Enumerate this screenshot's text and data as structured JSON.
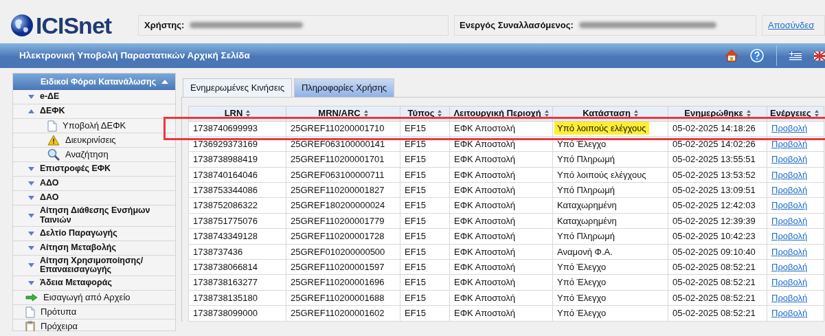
{
  "header": {
    "logo": "ICISnet",
    "user_label": "Χρήστης:",
    "trader_label": "Ενεργός Συναλλασόμενος:",
    "logout": "Αποσύνδεσ"
  },
  "title_bar": {
    "title": "Ηλεκτρονική Υποβολή Παραστατικών Αρχική Σελίδα"
  },
  "sidebar": {
    "title": "Ειδικοί Φόροι Κατανάλωσης",
    "expanded": true,
    "items": [
      {
        "kind": "group",
        "label": "e-ΔΕ",
        "expanded": false
      },
      {
        "kind": "group",
        "label": "ΔΕΦΚ",
        "expanded": true,
        "children": [
          {
            "kind": "document",
            "label": "Υποβολή ΔΕΦΚ"
          },
          {
            "kind": "warning",
            "label": "Διευκρινίσεις"
          },
          {
            "kind": "search",
            "label": "Αναζήτηση"
          }
        ]
      },
      {
        "kind": "group",
        "label": "Επιστροφές ΕΦΚ",
        "expanded": false
      },
      {
        "kind": "group",
        "label": "ΑΔΟ",
        "expanded": false
      },
      {
        "kind": "group",
        "label": "ΔΑΟ",
        "expanded": false
      },
      {
        "kind": "group",
        "label": "Αίτηση Διάθεσης Ενσήμων Ταινιών",
        "expanded": false
      },
      {
        "kind": "group",
        "label": "Δελτίο Παραγωγής",
        "expanded": false
      },
      {
        "kind": "group",
        "label": "Αίτηση Μεταβολής",
        "expanded": false
      },
      {
        "kind": "group",
        "label": "Αίτηση Χρησιμοποίησης/ Επαναεισαγωγής",
        "expanded": false
      },
      {
        "kind": "group",
        "label": "Άδεια Μεταφοράς",
        "expanded": false
      },
      {
        "kind": "import",
        "label": "Εισαγωγή από Αρχείο"
      },
      {
        "kind": "document",
        "label": "Πρότυπα"
      },
      {
        "kind": "clipboard",
        "label": "Πρόχειρα"
      }
    ]
  },
  "tabs": [
    {
      "label": "Ενημερωμένες Κινήσεις",
      "selected": true
    },
    {
      "label": "Πληροφορίες Χρήσης",
      "selected": false
    }
  ],
  "table": {
    "columns": [
      "LRN",
      "MRN/ARC",
      "Τύπος",
      "Λειτουργική Περιοχή",
      "Κατάσταση",
      "Ενημερώθηκε",
      "Ενέργειες"
    ],
    "rows": [
      {
        "lrn": "1738740699993",
        "mrn": "25GREF110200001710",
        "type": "EF15",
        "area": "ΕΦΚ Αποστολή",
        "status": "Υπό λοιπούς ελέγχους",
        "updated": "05-02-2025 14:18:26",
        "action": "Προβολή",
        "status_highlighted": true,
        "framed": true
      },
      {
        "lrn": "1736929373169",
        "mrn": "25GREF063100000141",
        "type": "EF15",
        "area": "ΕΦΚ Αποστολή",
        "status": "Υπό Έλεγχο",
        "updated": "05-02-2025 14:02:26",
        "action": "Προβολή",
        "status_highlighted": false,
        "framed": false
      },
      {
        "lrn": "1738738988419",
        "mrn": "25GREF110200001701",
        "type": "EF15",
        "area": "ΕΦΚ Αποστολή",
        "status": "Υπό Πληρωμή",
        "updated": "05-02-2025 13:55:51",
        "action": "Προβολή",
        "status_highlighted": false,
        "framed": false
      },
      {
        "lrn": "1738740164046",
        "mrn": "25GREF063100000711",
        "type": "EF15",
        "area": "ΕΦΚ Αποστολή",
        "status": "Υπό λοιπούς ελέγχους",
        "updated": "05-02-2025 13:53:52",
        "action": "Προβολή",
        "status_highlighted": false,
        "framed": false
      },
      {
        "lrn": "1738753344086",
        "mrn": "25GREF110200001827",
        "type": "EF15",
        "area": "ΕΦΚ Αποστολή",
        "status": "Υπό Πληρωμή",
        "updated": "05-02-2025 13:09:51",
        "action": "Προβολή",
        "status_highlighted": false,
        "framed": false
      },
      {
        "lrn": "1738752086322",
        "mrn": "25GREF180200000024",
        "type": "EF15",
        "area": "ΕΦΚ Αποστολή",
        "status": "Καταχωρημένη",
        "updated": "05-02-2025 12:42:03",
        "action": "Προβολή",
        "status_highlighted": false,
        "framed": false
      },
      {
        "lrn": "1738751775076",
        "mrn": "25GREF110200001779",
        "type": "EF15",
        "area": "ΕΦΚ Αποστολή",
        "status": "Καταχωρημένη",
        "updated": "05-02-2025 12:39:39",
        "action": "Προβολή",
        "status_highlighted": false,
        "framed": false
      },
      {
        "lrn": "1738743349128",
        "mrn": "25GREF110200001728",
        "type": "EF15",
        "area": "ΕΦΚ Αποστολή",
        "status": "Υπό Πληρωμή",
        "updated": "05-02-2025 10:42:23",
        "action": "Προβολή",
        "status_highlighted": false,
        "framed": false
      },
      {
        "lrn": "1738737436",
        "mrn": "25GREF010200000500",
        "type": "EF15",
        "area": "ΕΦΚ Αποστολή",
        "status": "Αναμονή Φ.Α.",
        "updated": "05-02-2025 09:10:40",
        "action": "Προβολή",
        "status_highlighted": false,
        "framed": false
      },
      {
        "lrn": "1738738066814",
        "mrn": "25GREF110200001597",
        "type": "EF15",
        "area": "ΕΦΚ Αποστολή",
        "status": "Υπό Έλεγχο",
        "updated": "05-02-2025 08:52:21",
        "action": "Προβολή",
        "status_highlighted": false,
        "framed": false
      },
      {
        "lrn": "1738738163277",
        "mrn": "25GREF110200001696",
        "type": "EF15",
        "area": "ΕΦΚ Αποστολή",
        "status": "Υπό Έλεγχο",
        "updated": "05-02-2025 08:52:21",
        "action": "Προβολή",
        "status_highlighted": false,
        "framed": false
      },
      {
        "lrn": "1738738135180",
        "mrn": "25GREF110200001688",
        "type": "EF15",
        "area": "ΕΦΚ Αποστολή",
        "status": "Υπό Έλεγχο",
        "updated": "05-02-2025 08:52:21",
        "action": "Προβολή",
        "status_highlighted": false,
        "framed": false
      },
      {
        "lrn": "1738738099000",
        "mrn": "25GREF110200001602",
        "type": "EF15",
        "area": "ΕΦΚ Αποστολή",
        "status": "Υπό Έλεγχο",
        "updated": "05-02-2025 08:52:21",
        "action": "Προβολή",
        "status_highlighted": false,
        "framed": false
      }
    ]
  }
}
